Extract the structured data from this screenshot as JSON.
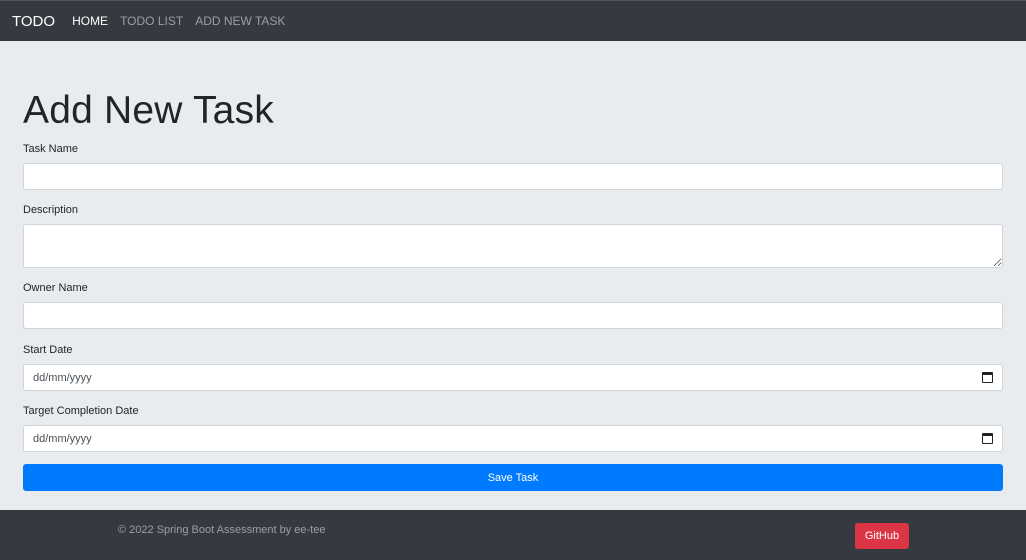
{
  "navbar": {
    "brand": "TODO",
    "links": [
      "HOME",
      "TODO LIST",
      "ADD NEW TASK"
    ]
  },
  "page": {
    "title": "Add New Task"
  },
  "form": {
    "task_name": {
      "label": "Task Name",
      "value": ""
    },
    "description": {
      "label": "Description",
      "value": ""
    },
    "owner_name": {
      "label": "Owner Name",
      "value": ""
    },
    "start_date": {
      "label": "Start Date",
      "placeholder": "dd/mm/yyyy"
    },
    "target_date": {
      "label": "Target Completion Date",
      "placeholder": "dd/mm/yyyy"
    },
    "save_label": "Save Task"
  },
  "footer": {
    "copyright": "© 2022 Spring Boot Assessment by ee-tee",
    "github_label": "GitHub"
  },
  "icons": {
    "date_picker": "calendar-icon"
  },
  "colors": {
    "navbar": "#343a40",
    "background": "#e9ecef",
    "primary": "#007bff",
    "danger": "#dc3545"
  }
}
